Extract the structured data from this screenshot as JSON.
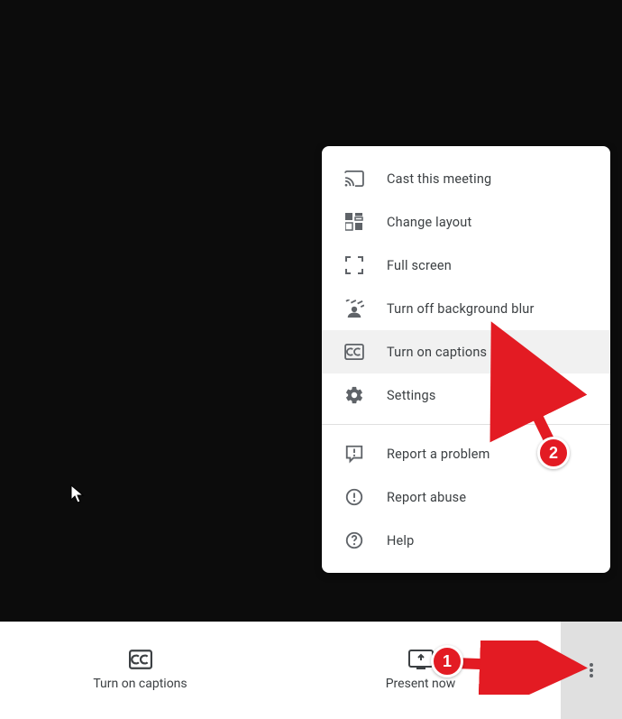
{
  "menu": {
    "items": [
      {
        "label": "Cast this meeting"
      },
      {
        "label": "Change layout"
      },
      {
        "label": "Full screen"
      },
      {
        "label": "Turn off background blur"
      },
      {
        "label": "Turn on captions"
      },
      {
        "label": "Settings"
      }
    ],
    "report_items": [
      {
        "label": "Report a problem"
      },
      {
        "label": "Report abuse"
      },
      {
        "label": "Help"
      }
    ]
  },
  "bottom_bar": {
    "captions_label": "Turn on captions",
    "present_label": "Present now"
  },
  "annotations": {
    "step1": "1",
    "step2": "2"
  }
}
